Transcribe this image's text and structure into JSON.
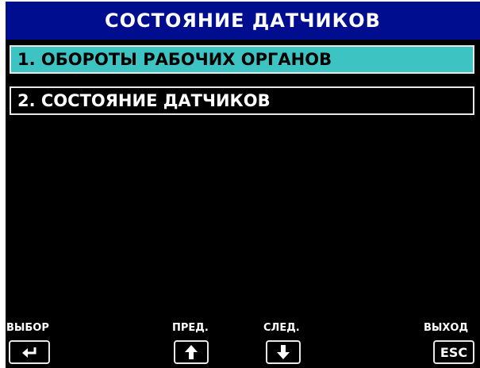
{
  "header": {
    "title": "СОСТОЯНИЕ ДАТЧИКОВ"
  },
  "menu": {
    "items": [
      {
        "label": "1. ОБОРОТЫ РАБОЧИХ ОРГАНОВ",
        "selected": true
      },
      {
        "label": "2. СОСТОЯНИЕ ДАТЧИКОВ",
        "selected": false
      }
    ]
  },
  "footer": {
    "select_label": "ВЫБОР",
    "prev_label": "ПРЕД.",
    "next_label": "СЛЕД.",
    "exit_label": "ВЫХОД",
    "esc_key": "ESC",
    "icons": {
      "select": "enter-arrow-icon",
      "prev": "arrow-up-icon",
      "next": "arrow-down-icon"
    }
  },
  "colors": {
    "header_bg": "#000d8f",
    "selected_bg": "#3ec3c3",
    "screen_bg": "#000000",
    "text": "#ffffff"
  }
}
